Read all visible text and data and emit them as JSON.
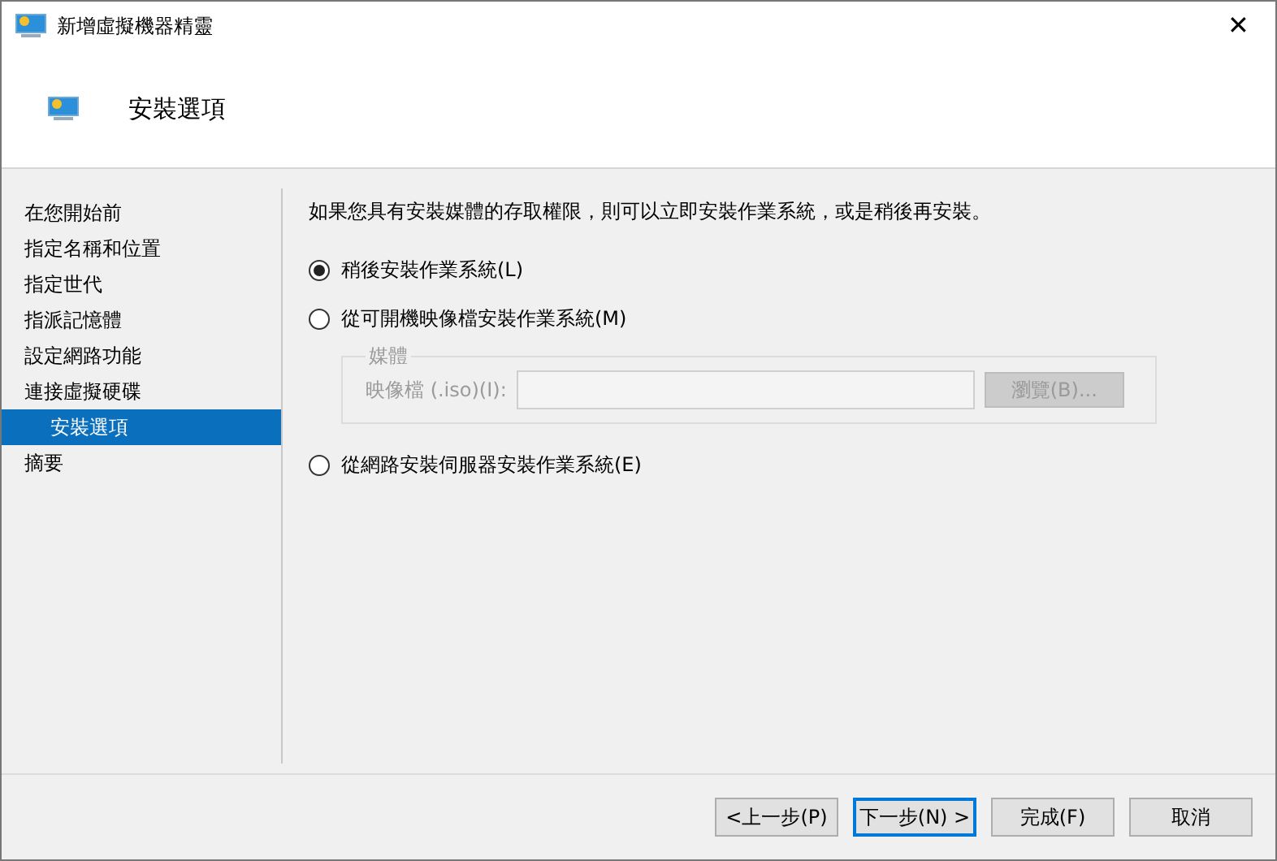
{
  "window": {
    "title": "新增虛擬機器精靈",
    "close": "✕"
  },
  "header": {
    "title": "安裝選項"
  },
  "steps": [
    {
      "label": "在您開始前",
      "selected": false
    },
    {
      "label": "指定名稱和位置",
      "selected": false
    },
    {
      "label": "指定世代",
      "selected": false
    },
    {
      "label": "指派記憶體",
      "selected": false
    },
    {
      "label": "設定網路功能",
      "selected": false
    },
    {
      "label": "連接虛擬硬碟",
      "selected": false,
      "children": [
        {
          "label": "安裝選項",
          "selected": true
        }
      ]
    },
    {
      "label": "摘要",
      "selected": false
    }
  ],
  "intro": "如果您具有安裝媒體的存取權限，則可以立即安裝作業系統，或是稍後再安裝。",
  "options": [
    {
      "label": "稍後安裝作業系統(L)",
      "selected": true
    },
    {
      "label": "從可開機映像檔安裝作業系統(M)",
      "selected": false,
      "media": {
        "legend": "媒體",
        "field_label": "映像檔 (.iso)(I):",
        "browse": "瀏覽(B)...",
        "disabled": true
      }
    },
    {
      "label": "從網路安裝伺服器安裝作業系統(E)",
      "selected": false
    }
  ],
  "buttons": [
    {
      "label": "<上一步(P)",
      "default": false
    },
    {
      "label": "下一步(N) >",
      "default": true
    },
    {
      "label": "完成(F)",
      "default": false
    },
    {
      "label": "取消",
      "default": false
    }
  ]
}
